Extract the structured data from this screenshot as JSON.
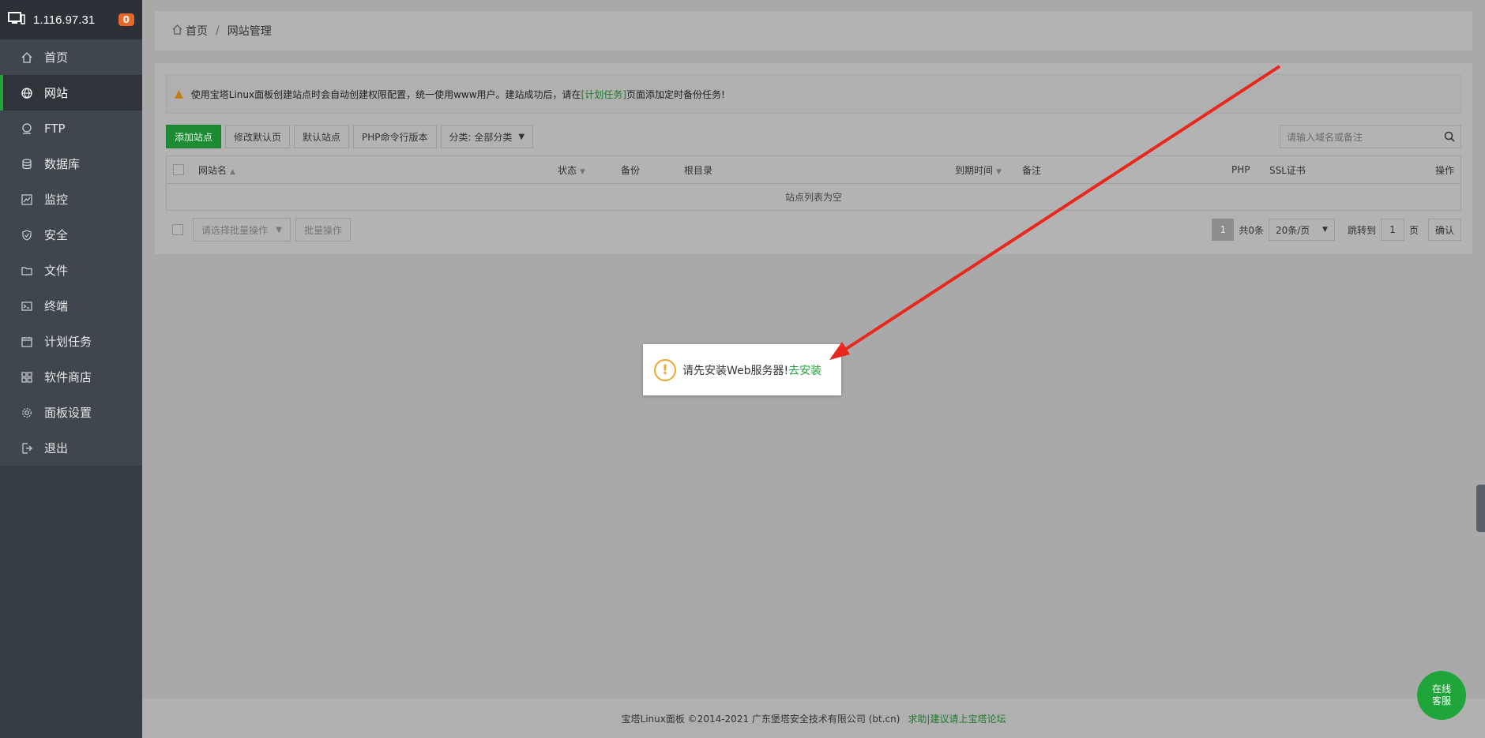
{
  "sidebar": {
    "ip": "1.116.97.31",
    "badge": "0",
    "items": [
      {
        "label": "首页",
        "icon": "home-icon"
      },
      {
        "label": "网站",
        "icon": "globe-icon",
        "active": true
      },
      {
        "label": "FTP",
        "icon": "ftp-icon"
      },
      {
        "label": "数据库",
        "icon": "database-icon"
      },
      {
        "label": "监控",
        "icon": "monitor-icon"
      },
      {
        "label": "安全",
        "icon": "shield-icon"
      },
      {
        "label": "文件",
        "icon": "folder-icon"
      },
      {
        "label": "终端",
        "icon": "terminal-icon"
      },
      {
        "label": "计划任务",
        "icon": "calendar-icon"
      },
      {
        "label": "软件商店",
        "icon": "apps-icon"
      },
      {
        "label": "面板设置",
        "icon": "gear-icon"
      },
      {
        "label": "退出",
        "icon": "logout-icon"
      }
    ]
  },
  "breadcrumb": {
    "home": "首页",
    "sep": "/",
    "current": "网站管理"
  },
  "notice": {
    "before": "使用宝塔Linux面板创建站点时会自动创建权限配置，统一使用www用户。建站成功后，请在",
    "link": "[计划任务]",
    "after": "页面添加定时备份任务!"
  },
  "toolbar": {
    "add_site": "添加站点",
    "modify_default_page": "修改默认页",
    "default_site": "默认站点",
    "php_cli_version": "PHP命令行版本",
    "category": "分类: 全部分类"
  },
  "search": {
    "placeholder": "请输入域名或备注"
  },
  "table": {
    "columns": {
      "name": "网站名",
      "status": "状态",
      "backup": "备份",
      "root": "根目录",
      "expire": "到期时间",
      "remark": "备注",
      "php": "PHP",
      "ssl": "SSL证书",
      "action": "操作"
    },
    "empty": "站点列表为空"
  },
  "batch": {
    "select_placeholder": "请选择批量操作",
    "button": "批量操作"
  },
  "pager": {
    "current": "1",
    "total": "共0条",
    "per_page": "20条/页",
    "jump_to": "跳转到",
    "jump_value": "1",
    "page_unit": "页",
    "confirm": "确认"
  },
  "toast": {
    "message": "请先安装Web服务器!",
    "install_link": "去安装"
  },
  "footer": {
    "copyright": "宝塔Linux面板 ©2014-2021 广东堡塔安全技术有限公司 (bt.cn)",
    "links": "求助|建议请上宝塔论坛"
  },
  "chat_button": {
    "line1": "在线",
    "line2": "客服"
  },
  "colors": {
    "accent": "#20a53a",
    "warning": "#f0a830",
    "arrow": "#e8271d",
    "sidebar_bg": "#363d45"
  }
}
